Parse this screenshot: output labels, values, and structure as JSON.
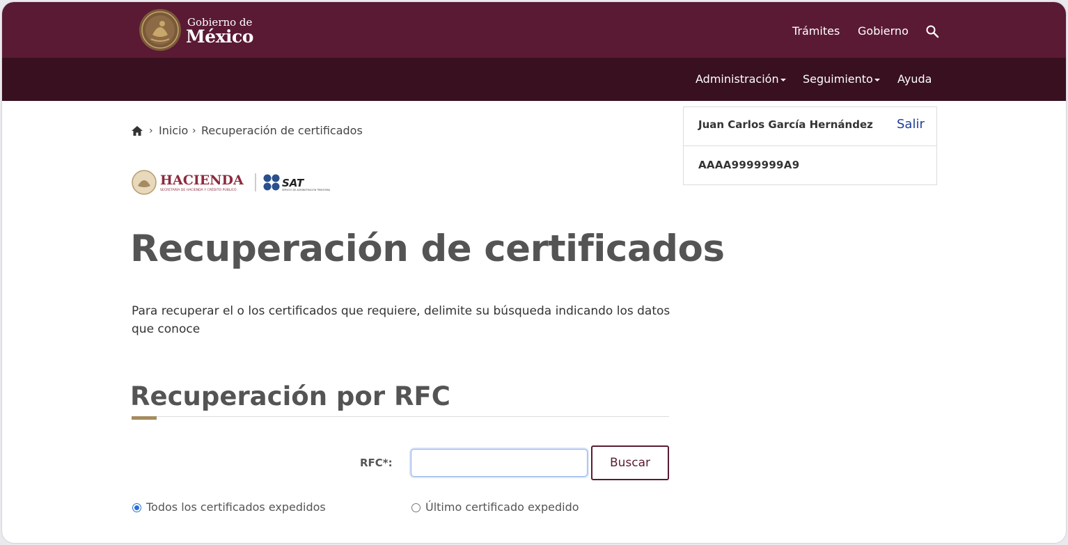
{
  "header": {
    "gov_line1": "Gobierno de",
    "gov_line2": "México",
    "links": [
      "Trámites",
      "Gobierno"
    ]
  },
  "subnav": {
    "items": [
      {
        "label": "Administración",
        "dropdown": true
      },
      {
        "label": "Seguimiento",
        "dropdown": true
      },
      {
        "label": "Ayuda",
        "dropdown": false
      }
    ]
  },
  "breadcrumb": {
    "items": [
      "Inicio",
      "Recuperación de certificados"
    ]
  },
  "logos": {
    "hacienda": "HACIENDA",
    "hacienda_sub": "SECRETARÍA DE HACIENDA Y CRÉDITO PÚBLICO",
    "sat": "SAT",
    "sat_sub": "SERVICIO DE ADMINISTRACIÓN TRIBUTARIA"
  },
  "main": {
    "title": "Recuperación de certificados",
    "intro": "Para recuperar el o los certificados que requiere, delimite su búsqueda indicando los datos que conoce",
    "section_title": "Recuperación por RFC",
    "form": {
      "rfc_label": "RFC*:",
      "rfc_value": "",
      "search_button": "Buscar",
      "options": [
        {
          "label": "Todos los certificados expedidos",
          "selected": true
        },
        {
          "label": "Último certificado expedido",
          "selected": false
        }
      ]
    }
  },
  "user": {
    "name": "Juan Carlos García Hernández",
    "logout": "Salir",
    "rfc": "AAAA9999999A9"
  },
  "colors": {
    "header": "#5a1a33",
    "subnav": "#381020",
    "accent": "#a58b5f",
    "link": "#1f3e97"
  }
}
